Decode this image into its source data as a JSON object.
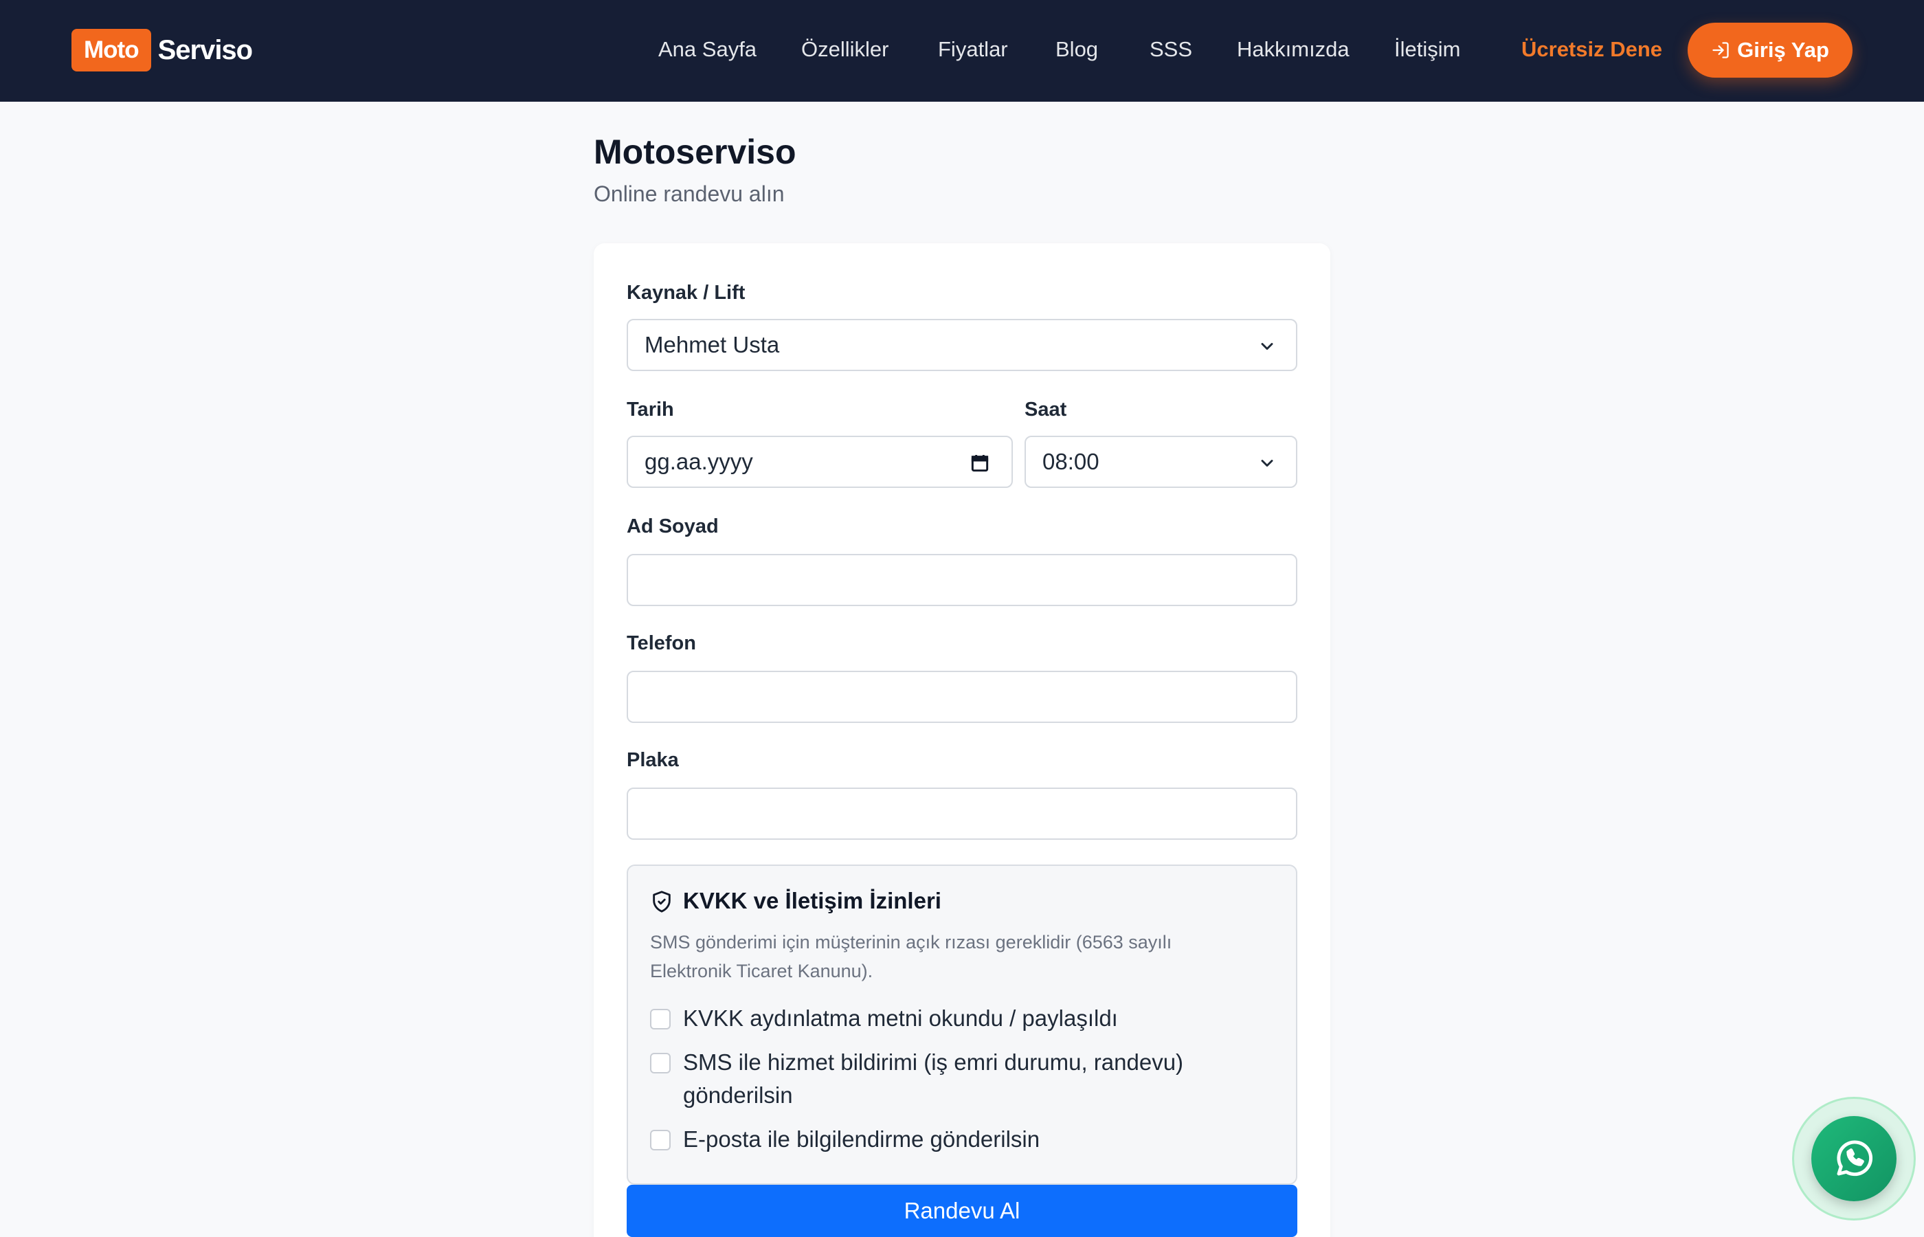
{
  "brand": {
    "badge": "Moto",
    "name": "Serviso",
    "accent": "#f2671d"
  },
  "nav": {
    "links": [
      "Ana Sayfa",
      "Özellikler",
      "Fiyatlar",
      "Blog",
      "SSS",
      "Hakkımızda",
      "İletişim"
    ],
    "cta": "Ücretsiz Dene",
    "login": "Giriş Yap"
  },
  "header": {
    "title": "Motoserviso",
    "subtitle": "Online randevu alın"
  },
  "form": {
    "resource_label": "Kaynak / Lift",
    "resource_value": "Mehmet Usta",
    "date_label": "Tarih",
    "date_value": "gg.aa.yyyy",
    "time_label": "Saat",
    "time_value": "08:00",
    "name_label": "Ad Soyad",
    "phone_label": "Telefon",
    "plate_label": "Plaka",
    "submit": "Randevu Al"
  },
  "kvkk": {
    "title": "KVKK ve İletişim İzinleri",
    "description": "SMS gönderimi için müşterinin açık rızası gereklidir (6563 sayılı Elektronik Ticaret Kanunu).",
    "consents": [
      "KVKK aydınlatma metni okundu / paylaşıldı",
      "SMS ile hizmet bildirimi (iş emri durumu, randevu) gönderilsin",
      "E-posta ile bilgilendirme gönderilsin"
    ]
  },
  "icons": {
    "dropdown": "chevron-down-icon",
    "date": "calendar-icon",
    "kvkk": "shield-check-icon",
    "chat": "whatsapp-icon",
    "login": "login-icon"
  }
}
